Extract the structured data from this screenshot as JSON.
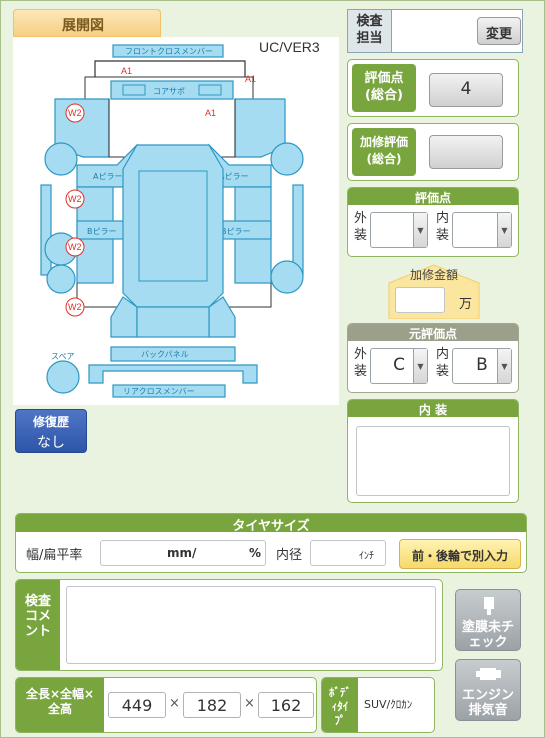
{
  "diagram": {
    "tab_label": "展開図",
    "version": "UC/VER3",
    "parts": {
      "front_cross_member": "フロントクロスメンバー",
      "core_support": "コアサポ",
      "a_pillar_left": "Aピラー",
      "a_pillar_right": "Aピラー",
      "b_pillar_left": "Bピラー",
      "b_pillar_right": "Bピラー",
      "back_panel": "バックパネル",
      "rear_cross_member": "リアクロスメンバー",
      "spare": "スペア"
    },
    "damage_marks": {
      "a1_front": "A1",
      "a1_front_right": "A1",
      "a1_core": "A1",
      "w2_1": "W2",
      "w2_2": "W2",
      "w2_3": "W2",
      "w2_4": "W2"
    }
  },
  "repair_history": {
    "label": "修復歴",
    "value": "なし"
  },
  "inspector": {
    "label": "検査担当",
    "change_button": "変更"
  },
  "grade": {
    "label": "評価点(総合)",
    "value": "4"
  },
  "repair_eval": {
    "label": "加修評価(総合)",
    "value": ""
  },
  "score": {
    "title": "評価点",
    "exterior_label": "外装",
    "interior_label": "内装",
    "exterior_value": "",
    "interior_value": ""
  },
  "repair_amount": {
    "label": "加修金額",
    "value": "",
    "unit": "万"
  },
  "original_score": {
    "title": "元評価点",
    "exterior_label": "外装",
    "interior_label": "内装",
    "exterior_value": "C",
    "interior_value": "B"
  },
  "interior": {
    "title": "内 装",
    "value": ""
  },
  "tire": {
    "title": "タイヤサイズ",
    "width_label": "幅/扁平率",
    "mm_unit": "mm/",
    "pct_unit": "%",
    "diameter_label": "内径",
    "inch_unit": "ｲﾝﾁ",
    "split_button": "前・後輪で別入力"
  },
  "comment": {
    "label": "検査コメント",
    "value": ""
  },
  "side_buttons": {
    "paint_uncheck": "塗膜未チェック",
    "engine_exhaust": "エンジン排気音"
  },
  "dimensions": {
    "label": "全長×全幅×全高",
    "length": "449",
    "width": "182",
    "height": "162",
    "sep": "×"
  },
  "body_type": {
    "label": "ﾎﾞﾃﾞｨﾀｲﾌﾟ",
    "value": "SUV/ｸﾛｶﾝ"
  },
  "colors": {
    "accent_green": "#78a53e",
    "panel_blue": "#a6dcf2",
    "damage_red": "#e0302a"
  }
}
